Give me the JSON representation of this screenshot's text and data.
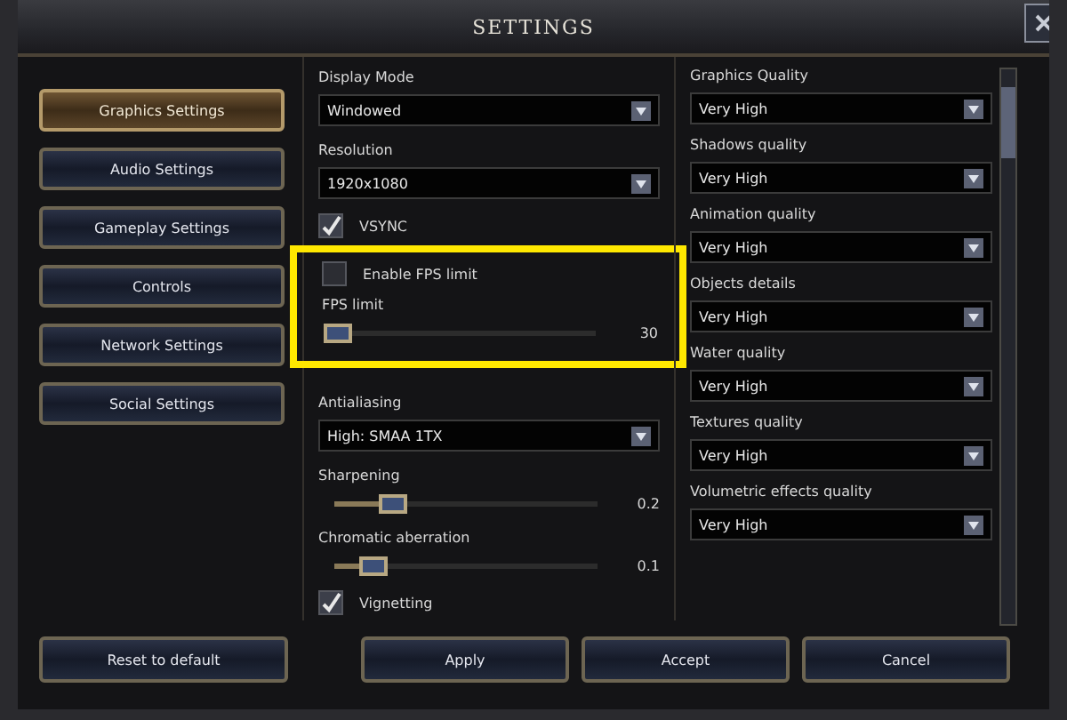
{
  "window": {
    "title": "SETTINGS"
  },
  "sidebar": {
    "items": [
      {
        "label": "Graphics Settings",
        "selected": true
      },
      {
        "label": "Audio Settings",
        "selected": false
      },
      {
        "label": "Gameplay Settings",
        "selected": false
      },
      {
        "label": "Controls",
        "selected": false
      },
      {
        "label": "Network Settings",
        "selected": false
      },
      {
        "label": "Social Settings",
        "selected": false
      }
    ]
  },
  "middle_column": [
    {
      "kind": "dropdown",
      "label": "Display Mode",
      "value": "Windowed"
    },
    {
      "kind": "dropdown",
      "label": "Resolution",
      "value": "1920x1080"
    },
    {
      "kind": "checkbox",
      "label": "VSYNC",
      "checked": true
    },
    {
      "kind": "highlight",
      "items": [
        {
          "kind": "checkbox",
          "label": "Enable FPS limit",
          "checked": false
        },
        {
          "kind": "slider",
          "label": "FPS limit",
          "level": 0.0,
          "reading": "30"
        }
      ]
    },
    {
      "kind": "divider"
    },
    {
      "kind": "dropdown",
      "label": "Antialiasing",
      "value": "High: SMAA 1TX"
    },
    {
      "kind": "slider",
      "label": "Sharpening",
      "level": 0.22,
      "reading": "0.2"
    },
    {
      "kind": "slider",
      "label": "Chromatic aberration",
      "level": 0.15,
      "reading": "0.1"
    },
    {
      "kind": "checkbox",
      "label": "Vignetting",
      "checked": true
    }
  ],
  "right_column": [
    {
      "label": "Graphics Quality",
      "value": "Very High"
    },
    {
      "label": "Shadows quality",
      "value": "Very High"
    },
    {
      "label": "Animation quality",
      "value": "Very High"
    },
    {
      "label": "Objects details",
      "value": "Very High"
    },
    {
      "label": "Water quality",
      "value": "Very High"
    },
    {
      "label": "Textures quality",
      "value": "Very High"
    },
    {
      "label": "Volumetric effects quality",
      "value": "Very High"
    }
  ],
  "footer": {
    "reset_button": "Reset to default",
    "buttons": [
      "Apply",
      "Accept",
      "Cancel"
    ]
  }
}
